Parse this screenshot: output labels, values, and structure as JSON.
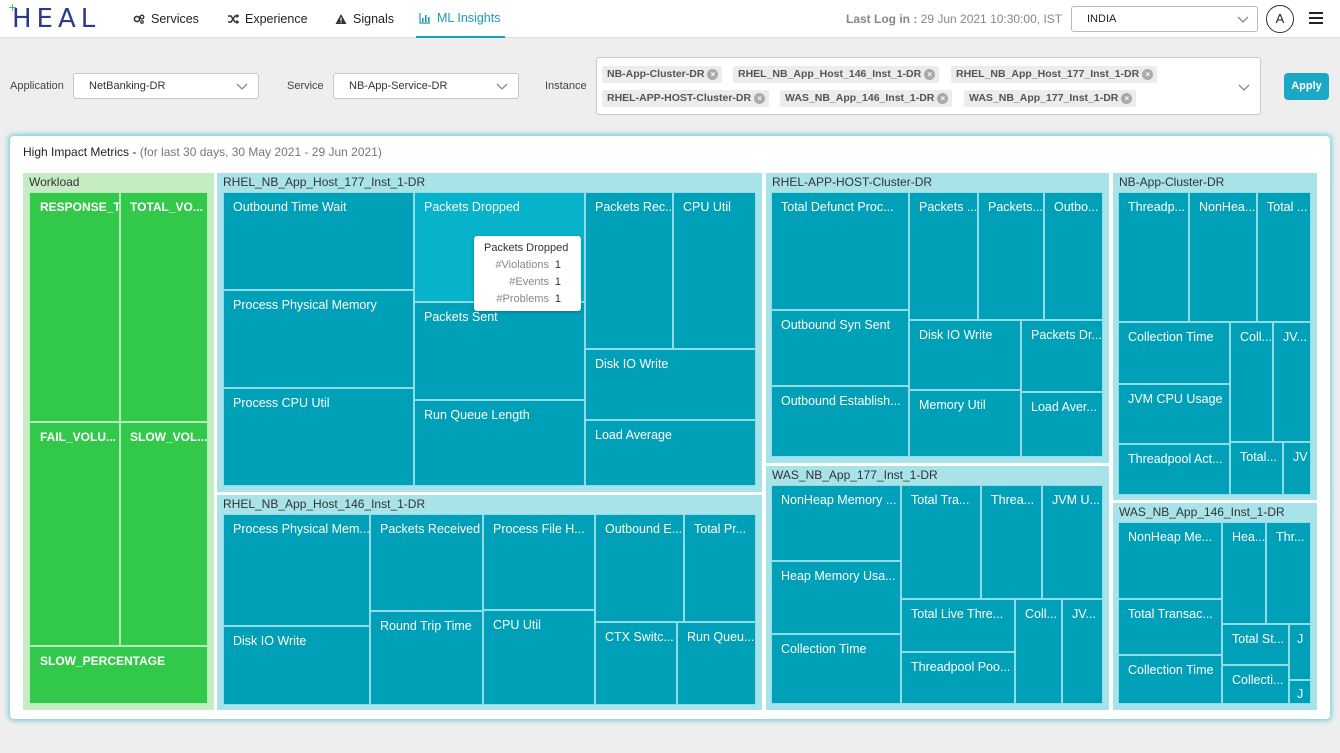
{
  "nav": {
    "logo": "HEAL",
    "items": [
      {
        "label": "Services",
        "icon": "services-gears-icon"
      },
      {
        "label": "Experience",
        "icon": "shuffle-icon"
      },
      {
        "label": "Signals",
        "icon": "warning-triangle-icon"
      },
      {
        "label": "ML Insights",
        "icon": "bar-chart-icon"
      }
    ],
    "last_log_label": "Last Log in :",
    "last_log_value": "29 Jun 2021 10:30:00, IST",
    "country": "INDIA",
    "avatar": "A"
  },
  "filters": {
    "application_label": "Application",
    "application_value": "NetBanking-DR",
    "service_label": "Service",
    "service_value": "NB-App-Service-DR",
    "instance_label": "Instance",
    "instances": [
      "NB-App-Cluster-DR",
      "RHEL_NB_App_Host_146_Inst_1-DR",
      "RHEL_NB_App_Host_177_Inst_1-DR",
      "RHEL-APP-HOST-Cluster-DR",
      "WAS_NB_App_146_Inst_1-DR",
      "WAS_NB_App_177_Inst_1-DR"
    ],
    "apply_label": "Apply"
  },
  "card": {
    "title": "High Impact Metrics - ",
    "subtitle": "(for last 30 days, 30 May 2021 - 29 Jun 2021)"
  },
  "treemap": {
    "workload": {
      "title": "Workload",
      "cells": [
        "RESPONSE_T...",
        "TOTAL_VO...",
        "FAIL_VOLU...",
        "SLOW_VOL...",
        "SLOW_PERCENTAGE"
      ]
    },
    "host177": {
      "title": "RHEL_NB_App_Host_177_Inst_1-DR",
      "cells": [
        "Outbound Time Wait",
        "Packets Dropped",
        "Packets Rec...",
        "CPU Util",
        "Process Physical Memory",
        "Packets Sent",
        "Disk IO Write",
        "Process CPU Util",
        "Run Queue Length",
        "Load Average"
      ]
    },
    "host146": {
      "title": "RHEL_NB_App_Host_146_Inst_1-DR",
      "cells": [
        "Process Physical Mem...",
        "Packets Received",
        "Process File H...",
        "Outbound E...",
        "Total Pr...",
        "Disk IO Write",
        "Round Trip Time",
        "CPU Util",
        "CTX Switc...",
        "Run Queu..."
      ]
    },
    "cluster": {
      "title": "RHEL-APP-HOST-Cluster-DR",
      "cells": [
        "Total Defunct Proc...",
        "Packets ...",
        "Packets...",
        "Outbo...",
        "Outbound Syn Sent",
        "Disk IO Write",
        "Packets Dr...",
        "Outbound Establish...",
        "Memory Util",
        "Load Aver..."
      ]
    },
    "was177": {
      "title": "WAS_NB_App_177_Inst_1-DR",
      "cells": [
        "NonHeap Memory ...",
        "Total Tra...",
        "Threa...",
        "JVM U...",
        "Heap Memory Usa...",
        "Total Live Thre...",
        "Coll...",
        "JV...",
        "Collection Time",
        "Threadpool Poo..."
      ]
    },
    "nbcluster": {
      "title": "NB-App-Cluster-DR",
      "cells": [
        "Threadp...",
        "NonHea...",
        "Total ...",
        "Collection Time",
        "Coll...",
        "JV...",
        "JVM CPU Usage",
        "Threadpool Act...",
        "Total...",
        "JV"
      ]
    },
    "was146": {
      "title": "WAS_NB_App_146_Inst_1-DR",
      "cells": [
        "NonHeap Me...",
        "Hea...",
        "Thr...",
        "Total Transac...",
        "Total St...",
        "J",
        "Collection Time",
        "Collecti...",
        "J"
      ]
    }
  },
  "tooltip": {
    "title": "Packets Dropped",
    "rows": [
      {
        "key": "#Violations",
        "value": "1"
      },
      {
        "key": "#Events",
        "value": "1"
      },
      {
        "key": "#Problems",
        "value": "1"
      }
    ]
  },
  "colors": {
    "accent": "#1ba8c5",
    "cell": "#00a0b8",
    "cell_hover": "#06b3cb",
    "workload": "#32c84a",
    "workload_bg": "#c6ecc3",
    "group_bg": "#a8e3ea"
  }
}
